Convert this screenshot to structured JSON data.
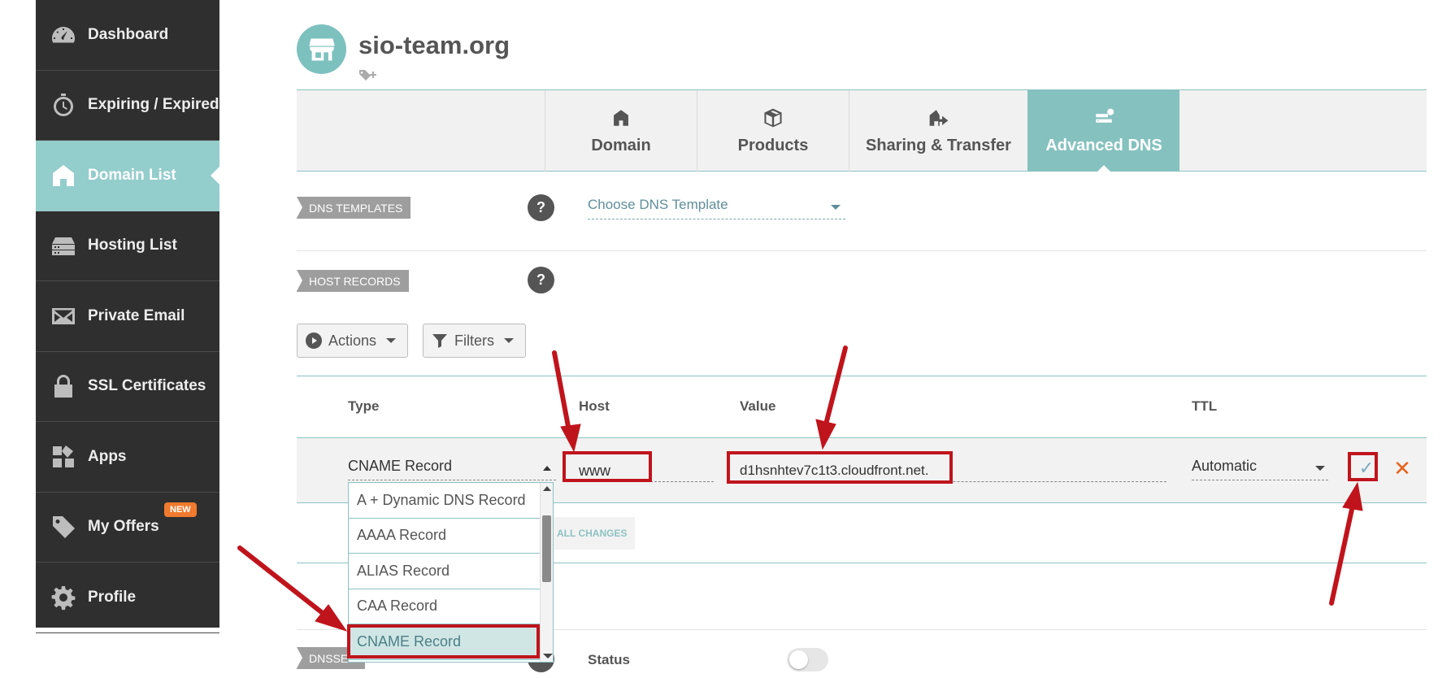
{
  "sidebar": {
    "items": [
      {
        "label": "Dashboard",
        "icon": "gauge-icon"
      },
      {
        "label": "Expiring / Expired",
        "icon": "timer-icon"
      },
      {
        "label": "Domain List",
        "icon": "home-icon"
      },
      {
        "label": "Hosting List",
        "icon": "server-icon"
      },
      {
        "label": "Private Email",
        "icon": "envelope-icon"
      },
      {
        "label": "SSL Certificates",
        "icon": "lock-icon"
      },
      {
        "label": "Apps",
        "icon": "apps-icon"
      },
      {
        "label": "My Offers",
        "icon": "tag-icon",
        "badge": "NEW"
      },
      {
        "label": "Profile",
        "icon": "gear-icon"
      }
    ],
    "active_index": 2
  },
  "domain": {
    "name": "sio-team.org"
  },
  "tabs": [
    {
      "label": "Domain",
      "icon": "home-icon"
    },
    {
      "label": "Products",
      "icon": "box-icon"
    },
    {
      "label": "Sharing & Transfer",
      "icon": "share-house-icon"
    },
    {
      "label": "Advanced DNS",
      "icon": "dns-icon",
      "active": true
    }
  ],
  "dns_templates": {
    "label": "DNS TEMPLATES",
    "help": "?",
    "placeholder": "Choose DNS Template"
  },
  "host_records": {
    "label": "HOST RECORDS",
    "help": "?",
    "actions_label": "Actions",
    "filters_label": "Filters",
    "columns": {
      "type": "Type",
      "host": "Host",
      "value": "Value",
      "ttl": "TTL"
    },
    "row": {
      "type": "CNAME Record",
      "host": "www",
      "value": "d1hsnhtev7c1t3.cloudfront.net.",
      "ttl": "Automatic"
    },
    "save_all_label": "ALL CHANGES"
  },
  "type_dropdown": {
    "options": [
      "A + Dynamic DNS Record",
      "AAAA Record",
      "ALIAS Record",
      "CAA Record",
      "CNAME Record"
    ],
    "selected": "CNAME Record"
  },
  "dnssec": {
    "label": "DNSSEC",
    "status_label": "Status",
    "enabled": false
  },
  "colors": {
    "teal_accent": "#85c1bf",
    "sidebar_bg": "#2f2f2f",
    "annotation_red": "#c0141c",
    "new_badge": "#f07a2d"
  }
}
